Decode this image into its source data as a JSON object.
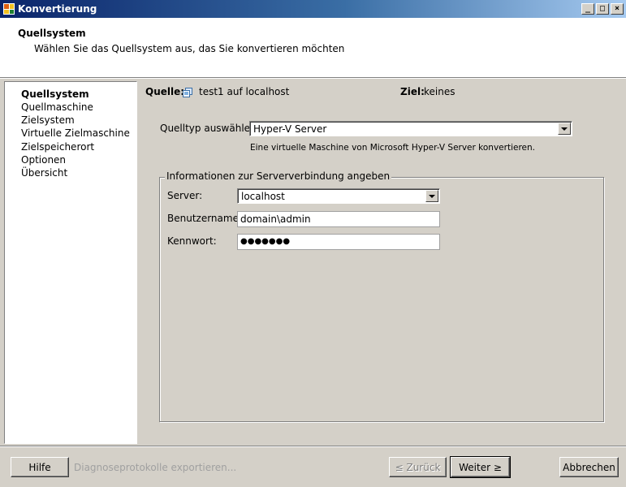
{
  "window": {
    "title": "Konvertierung",
    "controls": [
      "_",
      "□",
      "×"
    ]
  },
  "header": {
    "title": "Quellsystem",
    "subtitle": "Wählen Sie das Quellsystem aus, das Sie konvertieren möchten"
  },
  "nav": {
    "items": [
      {
        "label": "Quellsystem",
        "active": true
      },
      {
        "label": "Quellmaschine",
        "active": false
      },
      {
        "label": "Zielsystem",
        "active": false
      },
      {
        "label": "Virtuelle Zielmaschine",
        "active": false
      },
      {
        "label": "Zielspeicherort",
        "active": false
      },
      {
        "label": "Optionen",
        "active": false
      },
      {
        "label": "Übersicht",
        "active": false
      }
    ]
  },
  "summary": {
    "source_label": "Quelle:",
    "source_value": "test1 auf localhost",
    "target_label": "Ziel:",
    "target_value": "keines"
  },
  "source_type": {
    "label": "Quelltyp auswählen:",
    "value": "Hyper-V Server",
    "description": "Eine virtuelle Maschine von Microsoft Hyper-V Server konvertieren."
  },
  "connection": {
    "legend": "Informationen zur Serververbindung angeben",
    "server_label": "Server:",
    "server_value": "localhost",
    "username_label": "Benutzername:",
    "username_value": "domain\\admin",
    "password_label": "Kennwort:",
    "password_value": "●●●●●●●"
  },
  "footer": {
    "help": "Hilfe",
    "export_logs": "Diagnoseprotokolle exportieren...",
    "back": "≤ Zurück",
    "next": "Weiter ≥",
    "cancel": "Abbrechen"
  },
  "colors": {
    "titlebar_start": "#0a246a",
    "titlebar_end": "#a6caf0",
    "face": "#d4d0c8"
  }
}
